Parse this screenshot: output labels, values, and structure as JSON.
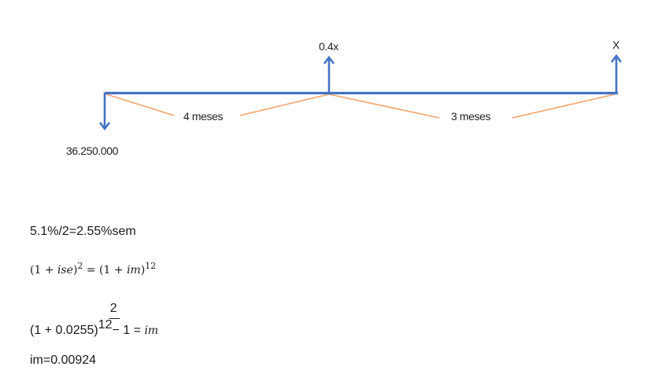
{
  "diagram": {
    "labels": {
      "top_middle": "0.4x",
      "top_right": "X",
      "down_value": "36.250.000",
      "period_1": "4 meses",
      "period_2": "3 meses"
    },
    "colors": {
      "timeline": "#4472c4",
      "arrows": "#4472c4",
      "brackets": "#f4a36a"
    }
  },
  "equations": {
    "line1": "5.1%/2=2.55%sem",
    "line2": {
      "open1": "(1 + ",
      "var1": "ise",
      "close1": ")",
      "exp1": "2",
      "mid": " = (1 + ",
      "var2": "im",
      "close2": ")",
      "exp2": "12"
    },
    "line3": {
      "base": "(1 + 0.0255)",
      "exp_num": "2",
      "exp_den": "12",
      "minus": "− 1 = ",
      "var": "im"
    },
    "line4": "im=0.00924"
  }
}
